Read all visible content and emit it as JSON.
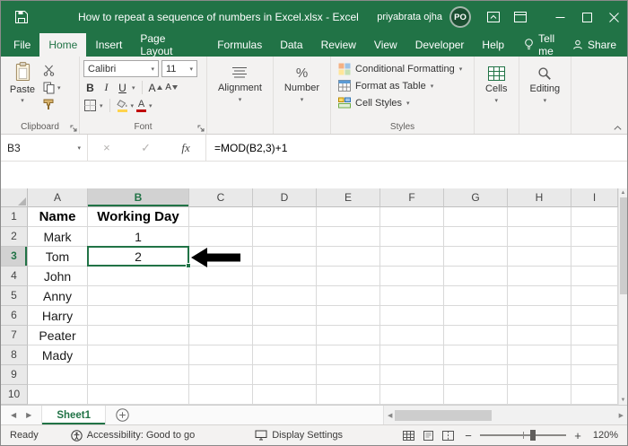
{
  "window": {
    "title": "How to repeat a sequence of numbers in Excel.xlsx  -  Excel",
    "user_name": "priyabrata ojha",
    "avatar_initials": "PO"
  },
  "menu": {
    "tabs": [
      {
        "label": "File",
        "active": false
      },
      {
        "label": "Home",
        "active": true
      },
      {
        "label": "Insert",
        "active": false
      },
      {
        "label": "Page Layout",
        "active": false
      },
      {
        "label": "Formulas",
        "active": false
      },
      {
        "label": "Data",
        "active": false
      },
      {
        "label": "Review",
        "active": false
      },
      {
        "label": "View",
        "active": false
      },
      {
        "label": "Developer",
        "active": false
      },
      {
        "label": "Help",
        "active": false
      }
    ],
    "tell_me_label": "Tell me",
    "share_label": "Share"
  },
  "ribbon": {
    "paste_label": "Paste",
    "clipboard_label": "Clipboard",
    "font_group_label": "Font",
    "font_name": "Calibri",
    "font_size": "11",
    "bold_label": "B",
    "italic_label": "I",
    "underline_label": "U",
    "increase_font_label": "A",
    "decrease_font_label": "A",
    "font_color_label": "A",
    "alignment_label": "Alignment",
    "number_label": "Number",
    "number_icon": "%",
    "conditional_formatting_label": "Conditional Formatting",
    "format_as_table_label": "Format as Table",
    "cell_styles_label": "Cell Styles",
    "styles_group_label": "Styles",
    "cells_label": "Cells",
    "editing_label": "Editing"
  },
  "formula_bar": {
    "name_box_value": "B3",
    "fx_label": "fx",
    "cancel_icon": "×",
    "enter_icon": "✓",
    "formula": "=MOD(B2,3)+1"
  },
  "sheet": {
    "column_headers": [
      "A",
      "B",
      "C",
      "D",
      "E",
      "F",
      "G",
      "H",
      "I"
    ],
    "selected_cell": "B3",
    "selected_column": "B",
    "selected_row": "3",
    "rows": [
      {
        "num": "1",
        "cells": [
          "Name",
          "Working Day",
          "",
          "",
          "",
          "",
          "",
          "",
          ""
        ]
      },
      {
        "num": "2",
        "cells": [
          "Mark",
          "1",
          "",
          "",
          "",
          "",
          "",
          "",
          ""
        ]
      },
      {
        "num": "3",
        "cells": [
          "Tom",
          "2",
          "",
          "",
          "",
          "",
          "",
          "",
          ""
        ]
      },
      {
        "num": "4",
        "cells": [
          "John",
          "",
          "",
          "",
          "",
          "",
          "",
          "",
          ""
        ]
      },
      {
        "num": "5",
        "cells": [
          "Anny",
          "",
          "",
          "",
          "",
          "",
          "",
          "",
          ""
        ]
      },
      {
        "num": "6",
        "cells": [
          "Harry",
          "",
          "",
          "",
          "",
          "",
          "",
          "",
          ""
        ]
      },
      {
        "num": "7",
        "cells": [
          "Peater",
          "",
          "",
          "",
          "",
          "",
          "",
          "",
          ""
        ]
      },
      {
        "num": "8",
        "cells": [
          "Mady",
          "",
          "",
          "",
          "",
          "",
          "",
          "",
          ""
        ]
      },
      {
        "num": "9",
        "cells": [
          "",
          "",
          "",
          "",
          "",
          "",
          "",
          "",
          ""
        ]
      },
      {
        "num": "10",
        "cells": [
          "",
          "",
          "",
          "",
          "",
          "",
          "",
          "",
          ""
        ]
      }
    ]
  },
  "sheet_tabs": {
    "active_tab_label": "Sheet1"
  },
  "status_bar": {
    "mode_label": "Ready",
    "accessibility_label": "Accessibility: Good to go",
    "display_settings_label": "Display Settings",
    "zoom_value": "120%"
  },
  "colors": {
    "excel_green": "#217346"
  }
}
